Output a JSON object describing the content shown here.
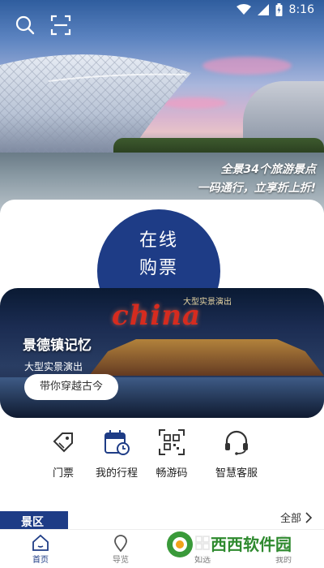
{
  "status_bar": {
    "time": "8:16"
  },
  "hero": {
    "slogan_line1": "全景34个旅游景点",
    "slogan_line2": "一码通行，立享折上折!"
  },
  "buy_ticket": {
    "line1": "在线",
    "line2": "购票"
  },
  "banner": {
    "poster_caption": "大型实景演出",
    "poster_word": "china",
    "title": "景德镇记忆",
    "subtitle": "大型实景演出",
    "button_label": "带你穿越古今"
  },
  "quick_menu": [
    {
      "label": "门票",
      "icon": "ticket-icon"
    },
    {
      "label": "我的行程",
      "icon": "calendar-clock-icon"
    },
    {
      "label": "畅游码",
      "icon": "qr-code-icon"
    },
    {
      "label": "智慧客服",
      "icon": "headset-icon"
    }
  ],
  "section": {
    "title": "景区",
    "more_label": "全部"
  },
  "tabbar": [
    {
      "label": "首页",
      "icon": "home-icon",
      "active": true
    },
    {
      "label": "导览",
      "icon": "location-pin-icon",
      "active": false
    },
    {
      "label": "如选",
      "icon": "grid-icon",
      "active": false
    },
    {
      "label": "我的",
      "icon": "user-icon",
      "active": false
    }
  ],
  "watermark": {
    "text": "西西软件园"
  },
  "colors": {
    "brand_blue": "#1e3c86",
    "show_red": "#d62b1f"
  }
}
